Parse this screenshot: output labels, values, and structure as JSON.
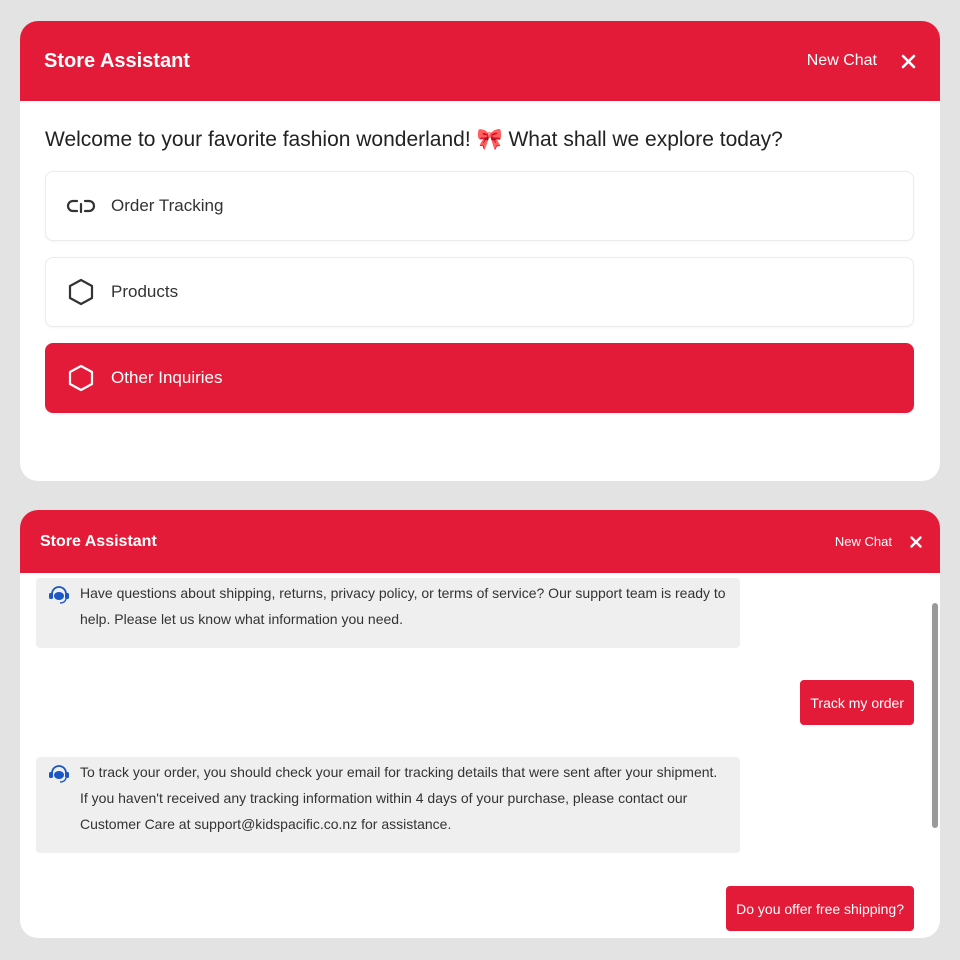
{
  "colors": {
    "accent": "#e41b38",
    "bubble_bg": "#efefef",
    "page_bg": "#e3e3e3"
  },
  "panel1": {
    "header": {
      "title": "Store Assistant",
      "new_chat_label": "New Chat",
      "close_icon": "close-icon"
    },
    "welcome_text": "Welcome to your favorite fashion wonderland! 🎀 What shall we explore today?",
    "options": [
      {
        "label": "Order Tracking",
        "icon": "link-icon",
        "selected": false
      },
      {
        "label": "Products",
        "icon": "hexagon-icon",
        "selected": false
      },
      {
        "label": "Other Inquiries",
        "icon": "hexagon-icon",
        "selected": true
      }
    ]
  },
  "panel2": {
    "header": {
      "title": "Store Assistant",
      "new_chat_label": "New Chat",
      "close_icon": "close-icon"
    },
    "messages": [
      {
        "from": "bot",
        "icon": "support-agent-icon",
        "text": "Have questions about shipping, returns, privacy policy, or terms of service? Our support team is ready to help. Please let us know what information you need."
      },
      {
        "from": "user",
        "text": "Track my order"
      },
      {
        "from": "bot",
        "icon": "support-agent-icon",
        "text": "To track your order, you should check your email for tracking details that were sent after your shipment. If you haven't received any tracking information within 4 days of your purchase, please contact our Customer Care at support@kidspacific.co.nz for assistance."
      },
      {
        "from": "user",
        "text": "Do you offer free shipping?"
      }
    ]
  }
}
